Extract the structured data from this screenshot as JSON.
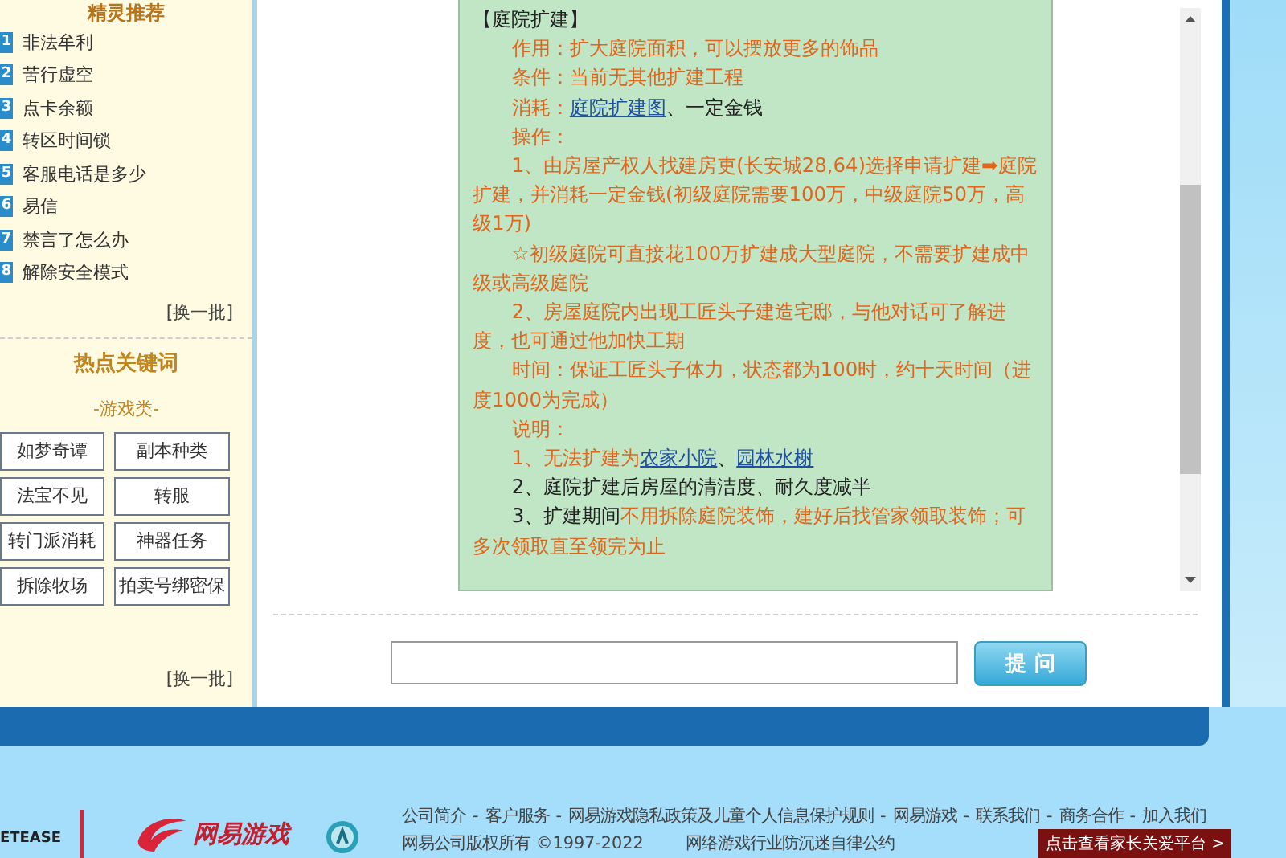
{
  "sidebar": {
    "title": "精灵推荐",
    "items": [
      {
        "number": "1",
        "label": "非法牟利"
      },
      {
        "number": "2",
        "label": "苦行虚空"
      },
      {
        "number": "3",
        "label": "点卡余额"
      },
      {
        "number": "4",
        "label": "转区时间锁"
      },
      {
        "number": "5",
        "label": "客服电话是多少"
      },
      {
        "number": "6",
        "label": "易信"
      },
      {
        "number": "7",
        "label": "禁言了怎么办"
      },
      {
        "number": "8",
        "label": "解除安全模式"
      }
    ],
    "refresh": "[换一批]",
    "keywords_title": "热点关键词",
    "keywords_category": "-游戏类-",
    "keywords": [
      "如梦奇谭",
      "副本种类",
      "法宝不见",
      "转服",
      "转门派消耗",
      "神器任务",
      "拆除牧场",
      "拍卖号绑密保"
    ],
    "keywords_refresh": "[换一批]"
  },
  "answer": {
    "lines": [
      {
        "indent": false,
        "segments": [
          {
            "kind": "plain",
            "text": "【庭院扩建】"
          }
        ]
      },
      {
        "indent": true,
        "segments": [
          {
            "kind": "orange",
            "text": "作用：扩大庭院面积，可以摆放更多的饰品"
          }
        ]
      },
      {
        "indent": true,
        "segments": [
          {
            "kind": "orange",
            "text": "条件：当前无其他扩建工程"
          }
        ]
      },
      {
        "indent": true,
        "segments": [
          {
            "kind": "orange",
            "text": "消耗："
          },
          {
            "kind": "link",
            "text": "庭院扩建图"
          },
          {
            "kind": "plain",
            "text": "、一定金钱"
          }
        ]
      },
      {
        "indent": true,
        "segments": [
          {
            "kind": "orange",
            "text": "操作："
          }
        ]
      },
      {
        "indent": true,
        "segments": [
          {
            "kind": "orange",
            "text": "1、由房屋产权人找建房吏(长安城28,64)选择申请扩建➡庭院扩建，并消耗一定金钱(初级庭院需要100万，中级庭院50万，高级1万)"
          }
        ]
      },
      {
        "indent": true,
        "segments": [
          {
            "kind": "orange",
            "text": "☆初级庭院可直接花100万扩建成大型庭院，不需要扩建成中级或高级庭院"
          }
        ]
      },
      {
        "indent": true,
        "segments": [
          {
            "kind": "orange",
            "text": "2、房屋庭院内出现工匠头子建造宅邸，与他对话可了解进度，也可通过他加快工期"
          }
        ]
      },
      {
        "indent": true,
        "segments": [
          {
            "kind": "orange",
            "text": "时间：保证工匠头子体力，状态都为100时，约十天时间（进度1000为完成）"
          }
        ]
      },
      {
        "indent": true,
        "segments": [
          {
            "kind": "orange",
            "text": "说明："
          }
        ]
      },
      {
        "indent": true,
        "segments": [
          {
            "kind": "orange",
            "text": "1、无法扩建为"
          },
          {
            "kind": "link",
            "text": "农家小院"
          },
          {
            "kind": "plain",
            "text": "、"
          },
          {
            "kind": "link",
            "text": "园林水榭"
          }
        ]
      },
      {
        "indent": true,
        "segments": [
          {
            "kind": "plain",
            "text": "2、庭院扩建后房屋的清洁度、耐久度减半"
          }
        ]
      },
      {
        "indent": true,
        "segments": [
          {
            "kind": "plain",
            "text": "3、扩建期间"
          },
          {
            "kind": "orange",
            "text": "不用拆除庭院装饰，建好后找管家领取装饰；可多次领取直至领完为止"
          }
        ]
      }
    ]
  },
  "ask": {
    "button": "提 问"
  },
  "footer": {
    "netease_logo": "ETEASE",
    "game_logo": "网易游戏",
    "separator": "-",
    "links": [
      "公司简介",
      "客户服务",
      "网易游戏隐私政策及儿童个人信息保护规则",
      "网易游戏",
      "联系我们",
      "商务合作",
      "加入我们"
    ],
    "copyright": "网易公司版权所有 ©1997-2022",
    "pledge": "网络游戏行业防沉迷自律公约",
    "parent_button": "点击查看家长关爱平台 >"
  }
}
